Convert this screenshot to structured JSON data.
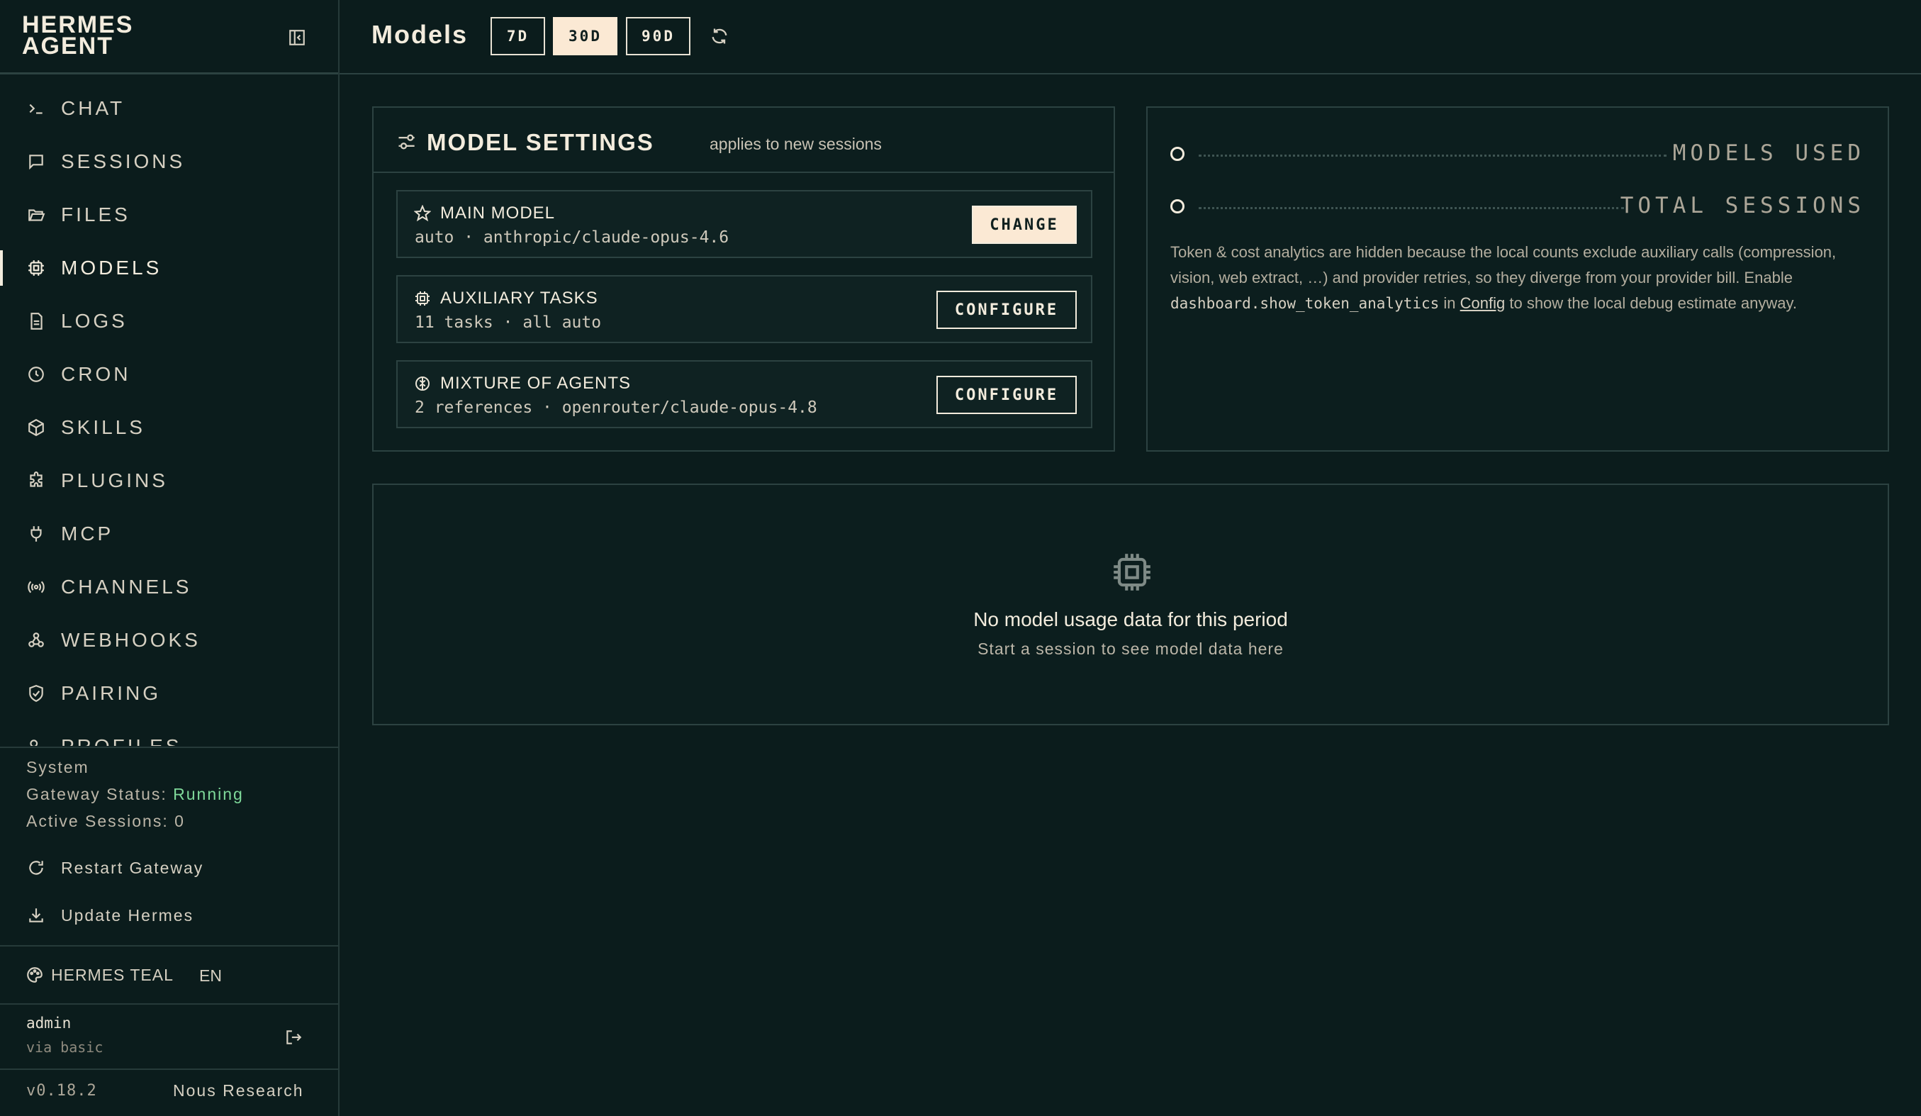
{
  "brand": {
    "line1": "HERMES",
    "line2": "AGENT"
  },
  "nav": [
    {
      "label": "CHAT",
      "icon": "terminal-icon"
    },
    {
      "label": "SESSIONS",
      "icon": "message-square-icon"
    },
    {
      "label": "FILES",
      "icon": "folder-open-icon"
    },
    {
      "label": "MODELS",
      "icon": "cpu-icon",
      "active": true
    },
    {
      "label": "LOGS",
      "icon": "file-text-icon"
    },
    {
      "label": "CRON",
      "icon": "clock-icon"
    },
    {
      "label": "SKILLS",
      "icon": "package-icon"
    },
    {
      "label": "PLUGINS",
      "icon": "puzzle-icon"
    },
    {
      "label": "MCP",
      "icon": "plug-icon"
    },
    {
      "label": "CHANNELS",
      "icon": "radio-icon"
    },
    {
      "label": "WEBHOOKS",
      "icon": "webhook-icon"
    },
    {
      "label": "PAIRING",
      "icon": "shield-check-icon"
    },
    {
      "label": "PROFILES",
      "icon": "users-icon"
    }
  ],
  "system": {
    "heading": "System",
    "gateway_label": "Gateway Status:",
    "gateway_value": "Running",
    "sessions_label": "Active Sessions:",
    "sessions_value": "0",
    "restart_label": "Restart Gateway",
    "update_label": "Update Hermes"
  },
  "theme": {
    "name": "HERMES TEAL",
    "lang": "EN"
  },
  "user": {
    "name": "admin",
    "auth": "via basic"
  },
  "footer": {
    "version": "v0.18.2",
    "org": "Nous Research"
  },
  "header": {
    "title": "Models",
    "ranges": [
      "7D",
      "30D",
      "90D"
    ],
    "active_range": "30D"
  },
  "settings": {
    "title": "MODEL SETTINGS",
    "subtitle": "applies to new sessions",
    "rows": [
      {
        "name": "MAIN MODEL",
        "value": "auto · anthropic/claude-opus-4.6",
        "button": "CHANGE",
        "icon": "star-icon"
      },
      {
        "name": "AUXILIARY TASKS",
        "value": "11 tasks · all auto",
        "button": "CONFIGURE",
        "icon": "cpu-icon"
      },
      {
        "name": "MIXTURE OF AGENTS",
        "value": "2 references · openrouter/claude-opus-4.8",
        "button": "CONFIGURE",
        "icon": "brain-icon"
      }
    ]
  },
  "stats": {
    "models_used_label": "MODELS USED",
    "total_sessions_label": "TOTAL SESSIONS",
    "note_1": "Token & cost analytics are hidden because the local counts exclude auxiliary calls (compression, vision, web extract, …) and provider retries, so they diverge from your provider bill. Enable ",
    "note_code": "dashboard.show_token_analytics",
    "note_2": " in ",
    "note_link": "Config",
    "note_3": " to show the local debug estimate anyway."
  },
  "usage": {
    "empty_title": "No model usage data for this period",
    "empty_sub": "Start a session to see model data here"
  },
  "colors": {
    "background": "#0b1c1c",
    "accent": "#fbe9d4",
    "running": "#7fd99a"
  }
}
